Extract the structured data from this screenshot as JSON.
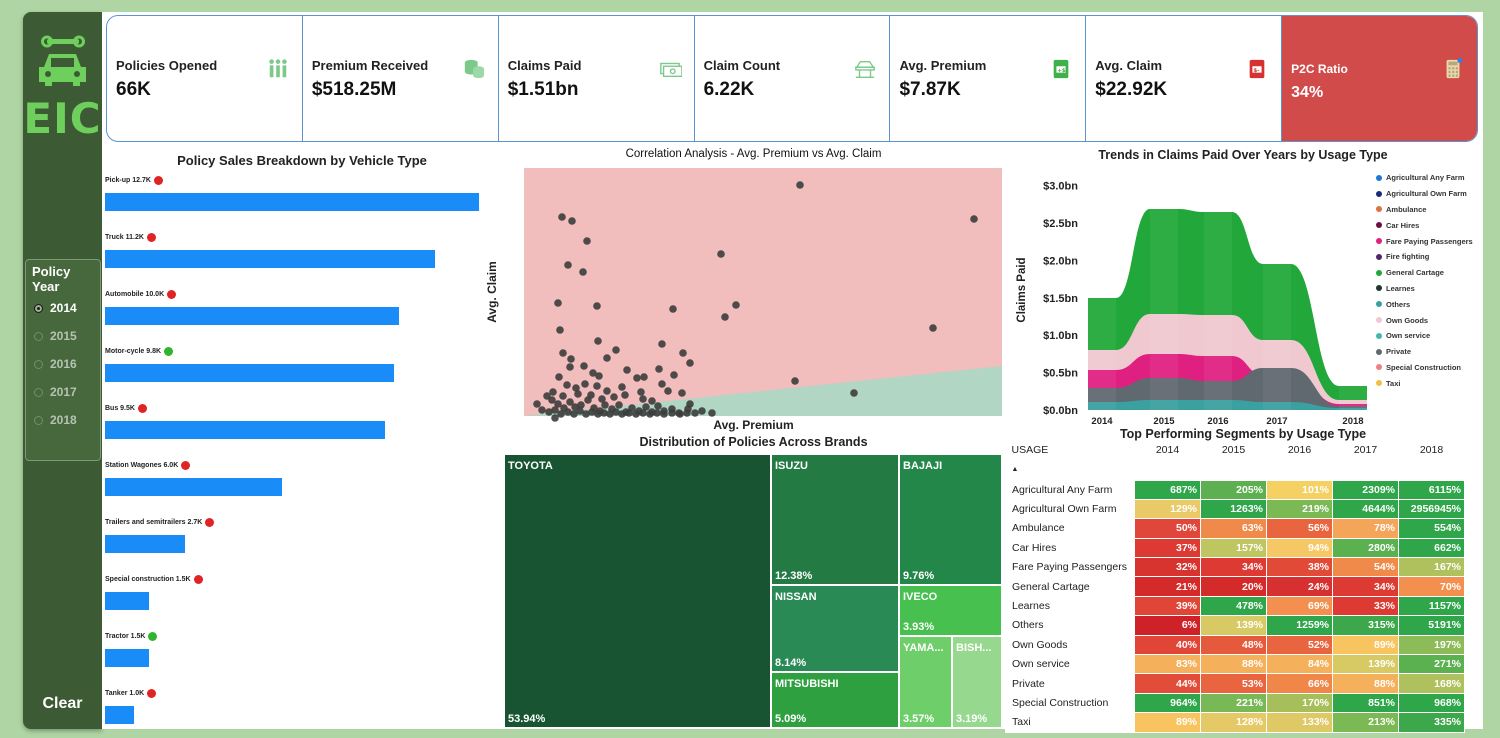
{
  "sidebar": {
    "logo_text": "EIC",
    "slicer_title": "Policy Year",
    "years": [
      {
        "label": "2014",
        "selected": true
      },
      {
        "label": "2015",
        "selected": false
      },
      {
        "label": "2016",
        "selected": false
      },
      {
        "label": "2017",
        "selected": false
      },
      {
        "label": "2018",
        "selected": false
      }
    ],
    "clear_label": "Clear"
  },
  "kpis": [
    {
      "label": "Policies Opened",
      "value": "66K",
      "icon": "people-icon"
    },
    {
      "label": "Premium Received",
      "value": "$518.25M",
      "icon": "coins-icon"
    },
    {
      "label": "Claims Paid",
      "value": "$1.51bn",
      "icon": "cash-icon"
    },
    {
      "label": "Claim Count",
      "value": "6.22K",
      "icon": "car-lift-icon"
    },
    {
      "label": "Avg. Premium",
      "value": "$7.87K",
      "icon": "money-plus-icon"
    },
    {
      "label": "Avg. Claim",
      "value": "$22.92K",
      "icon": "money-minus-icon"
    },
    {
      "label": "P2C Ratio",
      "value": "34%",
      "icon": "calculator-icon"
    }
  ],
  "vehicle_chart": {
    "title": "Policy Sales Breakdown by Vehicle Type",
    "rows": [
      {
        "label": "Pick-up 12.7K",
        "value": 12.7,
        "status": "red"
      },
      {
        "label": "Truck 11.2K",
        "value": 11.2,
        "status": "red"
      },
      {
        "label": "Automobile 10.0K",
        "value": 10.0,
        "status": "red"
      },
      {
        "label": "Motor-cycle 9.8K",
        "value": 9.8,
        "status": "green"
      },
      {
        "label": "Bus 9.5K",
        "value": 9.5,
        "status": "red"
      },
      {
        "label": "Station Wagones 6.0K",
        "value": 6.0,
        "status": "red"
      },
      {
        "label": "Trailers and semitrailers 2.7K",
        "value": 2.7,
        "status": "red"
      },
      {
        "label": "Special construction 1.5K",
        "value": 1.5,
        "status": "red"
      },
      {
        "label": "Tractor 1.5K",
        "value": 1.5,
        "status": "green"
      },
      {
        "label": "Tanker 1.0K",
        "value": 1.0,
        "status": "red"
      }
    ],
    "status_colors": {
      "red": "#e02424",
      "green": "#2fb52b"
    },
    "bar_color": "#1a8cf8"
  },
  "scatter": {
    "title": "Correlation Analysis - Avg. Premium vs Avg. Claim",
    "xlabel": "Avg. Premium",
    "ylabel": "Avg. Claim"
  },
  "stream": {
    "title": "Trends in Claims Paid Over Years by Usage Type",
    "ylabel": "Claims Paid",
    "yticks": [
      "$0.0bn",
      "$0.5bn",
      "$1.0bn",
      "$1.5bn",
      "$2.0bn",
      "$2.5bn",
      "$3.0bn"
    ],
    "years": [
      "2014",
      "2015",
      "2016",
      "2017",
      "2018"
    ],
    "legend": [
      {
        "name": "Agricultural Any Farm",
        "color": "#1f77d4"
      },
      {
        "name": "Agricultural Own Farm",
        "color": "#1a2a7a"
      },
      {
        "name": "Ambulance",
        "color": "#e07040"
      },
      {
        "name": "Car Hires",
        "color": "#6a1040"
      },
      {
        "name": "Fare Paying Passengers",
        "color": "#e02080"
      },
      {
        "name": "Fire fighting",
        "color": "#4a2a6a"
      },
      {
        "name": "General Cartage",
        "color": "#22a83a"
      },
      {
        "name": "Learnes",
        "color": "#1c3a2a"
      },
      {
        "name": "Others",
        "color": "#3aa0a0"
      },
      {
        "name": "Own Goods",
        "color": "#f0c8d0"
      },
      {
        "name": "Own service",
        "color": "#40b8b0"
      },
      {
        "name": "Private",
        "color": "#606870"
      },
      {
        "name": "Special Construction",
        "color": "#f08080"
      },
      {
        "name": "Taxi",
        "color": "#f0c040"
      }
    ]
  },
  "treemap": {
    "title": "Distribution of Policies Across Brands",
    "tiles": [
      {
        "name": "TOYOTA",
        "pct": "53.94%",
        "color": "#185432"
      },
      {
        "name": "ISUZU",
        "pct": "12.38%",
        "color": "#237a42"
      },
      {
        "name": "BAJAJI",
        "pct": "9.76%",
        "color": "#23874a"
      },
      {
        "name": "NISSAN",
        "pct": "8.14%",
        "color": "#2a8a55"
      },
      {
        "name": "IVECO",
        "pct": "3.93%",
        "color": "#47c04f"
      },
      {
        "name": "MITSUBISHI",
        "pct": "5.09%",
        "color": "#2ea040"
      },
      {
        "name": "YAMA...",
        "pct": "3.57%",
        "color": "#6ecf6a"
      },
      {
        "name": "BISH...",
        "pct": "3.19%",
        "color": "#97d88f"
      }
    ]
  },
  "matrix": {
    "title": "Top Performing Segments by Usage Type",
    "corner": "USAGE",
    "years": [
      "2014",
      "2015",
      "2016",
      "2017",
      "2018"
    ],
    "rows": [
      {
        "label": "Agricultural Any Farm",
        "cells": [
          "687%",
          "205%",
          "101%",
          "2309%",
          "6115%"
        ],
        "colors": [
          "#2fa64a",
          "#5cb050",
          "#f5d063",
          "#2fa64a",
          "#2fa64a"
        ]
      },
      {
        "label": "Agricultural Own Farm",
        "cells": [
          "129%",
          "1263%",
          "219%",
          "4644%",
          "2956945%"
        ],
        "colors": [
          "#e9c968",
          "#2fa64a",
          "#7bb955",
          "#2fa64a",
          "#2fa64a"
        ]
      },
      {
        "label": "Ambulance",
        "cells": [
          "50%",
          "63%",
          "56%",
          "78%",
          "554%"
        ],
        "colors": [
          "#e0463a",
          "#ef8a4a",
          "#e8653f",
          "#f4a55a",
          "#2fa64a"
        ]
      },
      {
        "label": "Car Hires",
        "cells": [
          "37%",
          "157%",
          "94%",
          "280%",
          "662%"
        ],
        "colors": [
          "#dd3a34",
          "#bfc560",
          "#f5c865",
          "#5bb050",
          "#2fa64a"
        ]
      },
      {
        "label": "Fare Paying Passengers",
        "cells": [
          "32%",
          "34%",
          "38%",
          "54%",
          "167%"
        ],
        "colors": [
          "#d8342f",
          "#dc3a32",
          "#e24a38",
          "#ef8a4a",
          "#aec15c"
        ]
      },
      {
        "label": "General Cartage",
        "cells": [
          "21%",
          "20%",
          "24%",
          "34%",
          "70%"
        ],
        "colors": [
          "#d42a2a",
          "#d42a2a",
          "#d63030",
          "#dc3a32",
          "#f39050"
        ]
      },
      {
        "label": "Learnes",
        "cells": [
          "39%",
          "478%",
          "69%",
          "33%",
          "1157%"
        ],
        "colors": [
          "#e04538",
          "#2fa64a",
          "#f39050",
          "#dc3a32",
          "#2fa64a"
        ]
      },
      {
        "label": "Others",
        "cells": [
          "6%",
          "139%",
          "1259%",
          "315%",
          "5191%"
        ],
        "colors": [
          "#cf2228",
          "#d7c964",
          "#2fa64a",
          "#3da74b",
          "#2fa64a"
        ]
      },
      {
        "label": "Own Goods",
        "cells": [
          "40%",
          "48%",
          "52%",
          "89%",
          "197%"
        ],
        "colors": [
          "#e04538",
          "#e55a3c",
          "#e8653f",
          "#f7c460",
          "#8dbb58"
        ]
      },
      {
        "label": "Own service",
        "cells": [
          "83%",
          "88%",
          "84%",
          "139%",
          "271%"
        ],
        "colors": [
          "#f5b05c",
          "#f5b05c",
          "#f5b05c",
          "#d7c964",
          "#5bb050"
        ]
      },
      {
        "label": "Private",
        "cells": [
          "44%",
          "53%",
          "66%",
          "88%",
          "168%"
        ],
        "colors": [
          "#e24d39",
          "#e8653f",
          "#f08748",
          "#f5b05c",
          "#aec15c"
        ]
      },
      {
        "label": "Special Construction",
        "cells": [
          "964%",
          "221%",
          "170%",
          "851%",
          "968%"
        ],
        "colors": [
          "#2fa64a",
          "#78b857",
          "#a7bf5b",
          "#2fa64a",
          "#2fa64a"
        ]
      },
      {
        "label": "Taxi",
        "cells": [
          "89%",
          "128%",
          "133%",
          "213%",
          "335%"
        ],
        "colors": [
          "#f7c460",
          "#e6c967",
          "#dfc966",
          "#7bb955",
          "#3da74b"
        ]
      }
    ]
  },
  "colors": {
    "sidebar": "#3c5a33",
    "kpi_border": "#5b95d1",
    "p2c_card": "#d24b4b",
    "scatter_bg": "#f2bdbd",
    "scatter_band": "#b1d6c3"
  }
}
